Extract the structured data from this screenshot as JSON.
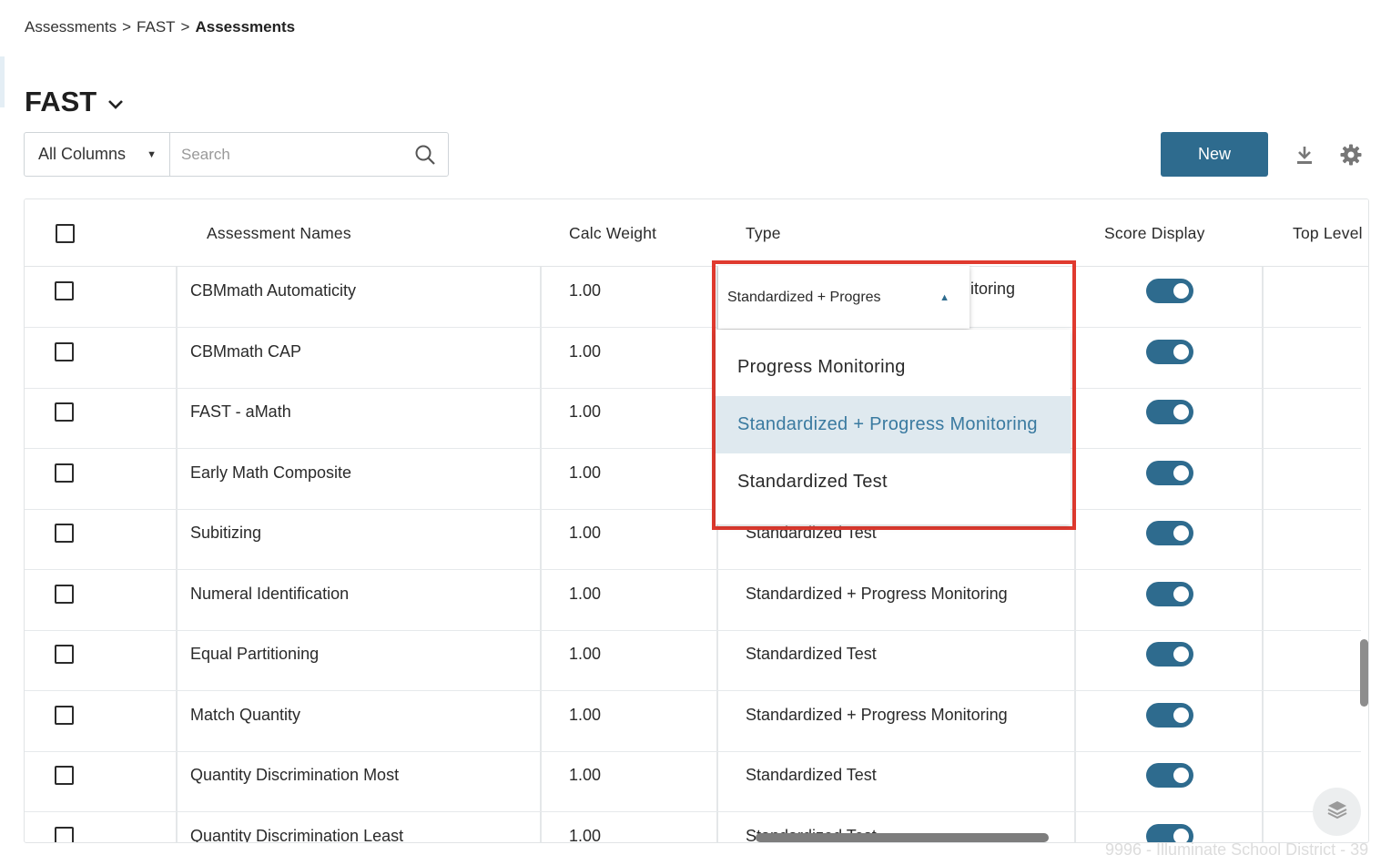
{
  "breadcrumb": {
    "part1": "Assessments",
    "sep1": ">",
    "part2": "FAST",
    "sep2": ">",
    "current": "Assessments"
  },
  "page": {
    "title": "FAST"
  },
  "toolbar": {
    "column_filter": "All Columns",
    "search_placeholder": "Search",
    "new_label": "New",
    "icons": [
      "download-icon",
      "gear-icon",
      "search-icon",
      "layers-icon"
    ]
  },
  "table": {
    "headers": {
      "names": "Assessment Names",
      "calc_weight": "Calc Weight",
      "type": "Type",
      "score_display": "Score Display",
      "top_level": "Top Level"
    },
    "rows": [
      {
        "name": "CBMmath Automaticity",
        "weight": "1.00",
        "type": "",
        "score_display": true
      },
      {
        "name": "CBMmath CAP",
        "weight": "1.00",
        "type": "",
        "score_display": true
      },
      {
        "name": "FAST - aMath",
        "weight": "1.00",
        "type": "",
        "score_display": true
      },
      {
        "name": "Early Math Composite",
        "weight": "1.00",
        "type": "",
        "score_display": true
      },
      {
        "name": "Subitizing",
        "weight": "1.00",
        "type": "Standardized Test",
        "score_display": true
      },
      {
        "name": "Numeral Identification",
        "weight": "1.00",
        "type": "Standardized + Progress Monitoring",
        "score_display": true
      },
      {
        "name": "Equal Partitioning",
        "weight": "1.00",
        "type": "Standardized Test",
        "score_display": true
      },
      {
        "name": "Match Quantity",
        "weight": "1.00",
        "type": "Standardized + Progress Monitoring",
        "score_display": true
      },
      {
        "name": "Quantity Discrimination Most",
        "weight": "1.00",
        "type": "Standardized Test",
        "score_display": true
      },
      {
        "name": "Quantity Discrimination Least",
        "weight": "1.00",
        "type": "Standardized Test",
        "score_display": true
      }
    ]
  },
  "type_dropdown": {
    "selected_text": "Standardized + Progres",
    "behind_text": "itoring",
    "options": [
      "Progress Monitoring",
      "Standardized + Progress Monitoring",
      "Standardized Test"
    ],
    "selected_index": 1
  },
  "footer": {
    "watermark": "9996 - Illuminate School District - 39"
  },
  "colors": {
    "accent": "#2e6b8e",
    "highlight": "#e03a2f",
    "selected_option_bg": "#dfe9ef"
  }
}
